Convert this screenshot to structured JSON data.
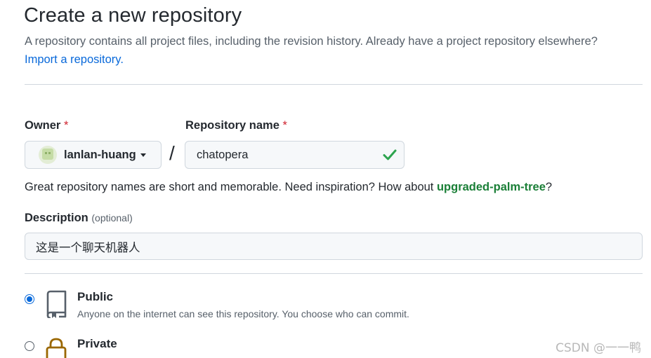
{
  "page": {
    "title": "Create a new repository",
    "subtitle": "A repository contains all project files, including the revision history. Already have a project repository elsewhere?",
    "import_link": "Import a repository."
  },
  "owner": {
    "label": "Owner",
    "required_mark": "*",
    "selected": "lanlan-huang",
    "avatar_icon": "identicon-avatar"
  },
  "separator": "/",
  "repository_name": {
    "label": "Repository name",
    "required_mark": "*",
    "value": "chatopera",
    "status_icon": "check-icon",
    "status_color": "#2da44e"
  },
  "name_hint": {
    "text": "Great repository names are short and memorable. Need inspiration? How about ",
    "suggestion": "upgraded-palm-tree",
    "suffix": "?"
  },
  "description": {
    "label": "Description",
    "optional": "(optional)",
    "value": "这是一个聊天机器人"
  },
  "visibility": {
    "options": [
      {
        "title": "Public",
        "description": "Anyone on the internet can see this repository. You choose who can commit.",
        "checked": true,
        "icon": "repo-book-icon"
      },
      {
        "title": "Private",
        "description": "",
        "checked": false,
        "icon": "lock-icon",
        "icon_color": "#9a6700"
      }
    ]
  },
  "watermark": "CSDN @一一鸭",
  "colors": {
    "link": "#0969da",
    "suggestion": "#1a7f37",
    "required": "#cf222e"
  }
}
